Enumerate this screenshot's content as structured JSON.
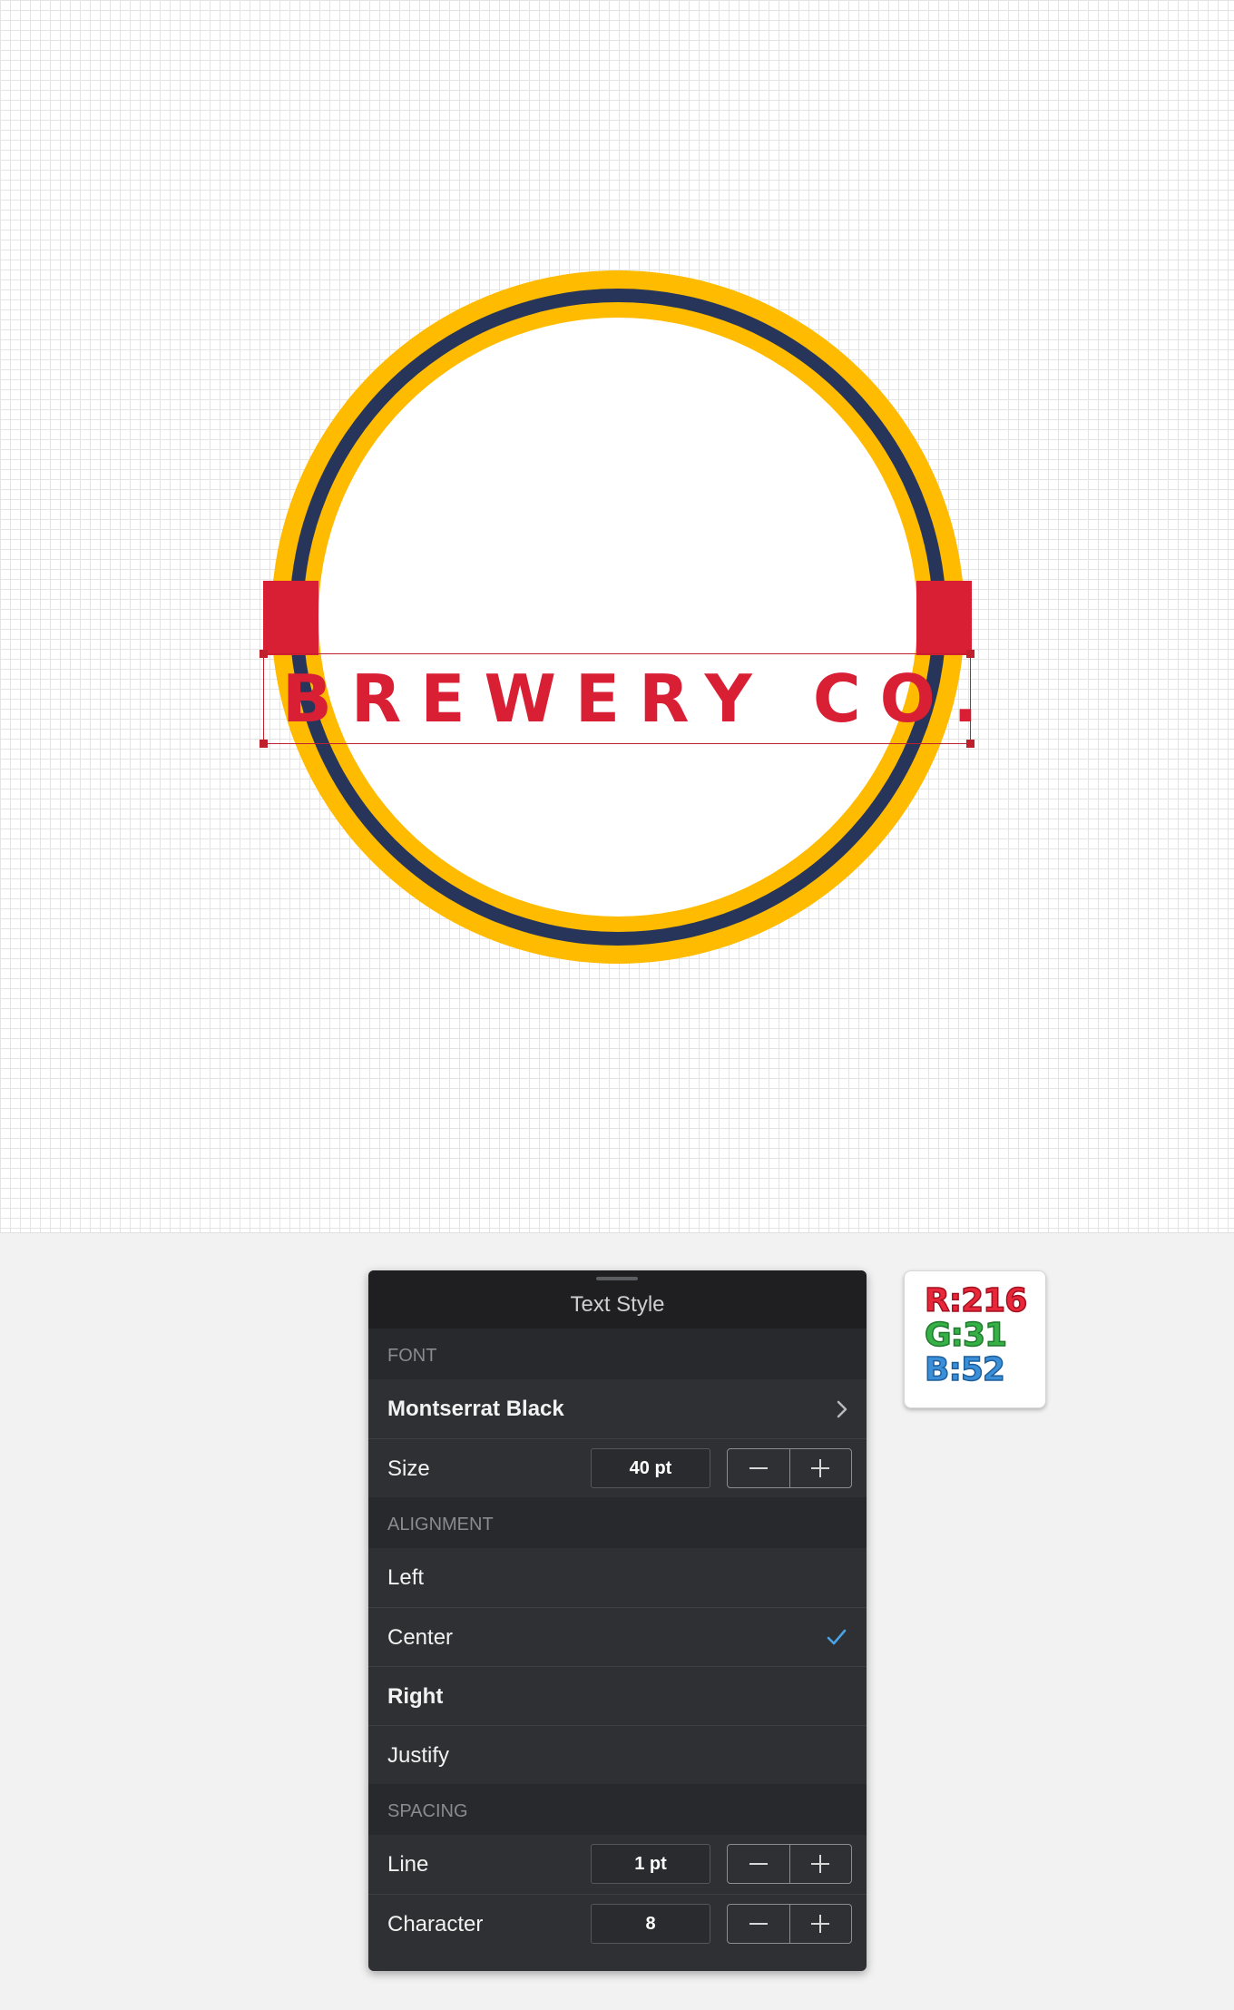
{
  "canvas": {
    "badge_text": "BREWERY CO.",
    "colors": {
      "yellow": "#ffbb00",
      "navy": "#27355a",
      "red": "#d81f34",
      "white": "#ffffff"
    }
  },
  "panel": {
    "title": "Text Style",
    "sections": {
      "font": "FONT",
      "alignment": "ALIGNMENT",
      "spacing": "SPACING"
    },
    "font_name": "Montserrat Black",
    "size_label": "Size",
    "size_value": "40 pt",
    "alignment_options": [
      "Left",
      "Center",
      "Right",
      "Justify"
    ],
    "selected_alignment": "Center",
    "line_label": "Line",
    "line_value": "1 pt",
    "character_label": "Character",
    "character_value": "8",
    "accent_color": "#4aa3e6"
  },
  "color_chip": {
    "r": "R:216",
    "g": "G:31",
    "b": "B:52"
  }
}
